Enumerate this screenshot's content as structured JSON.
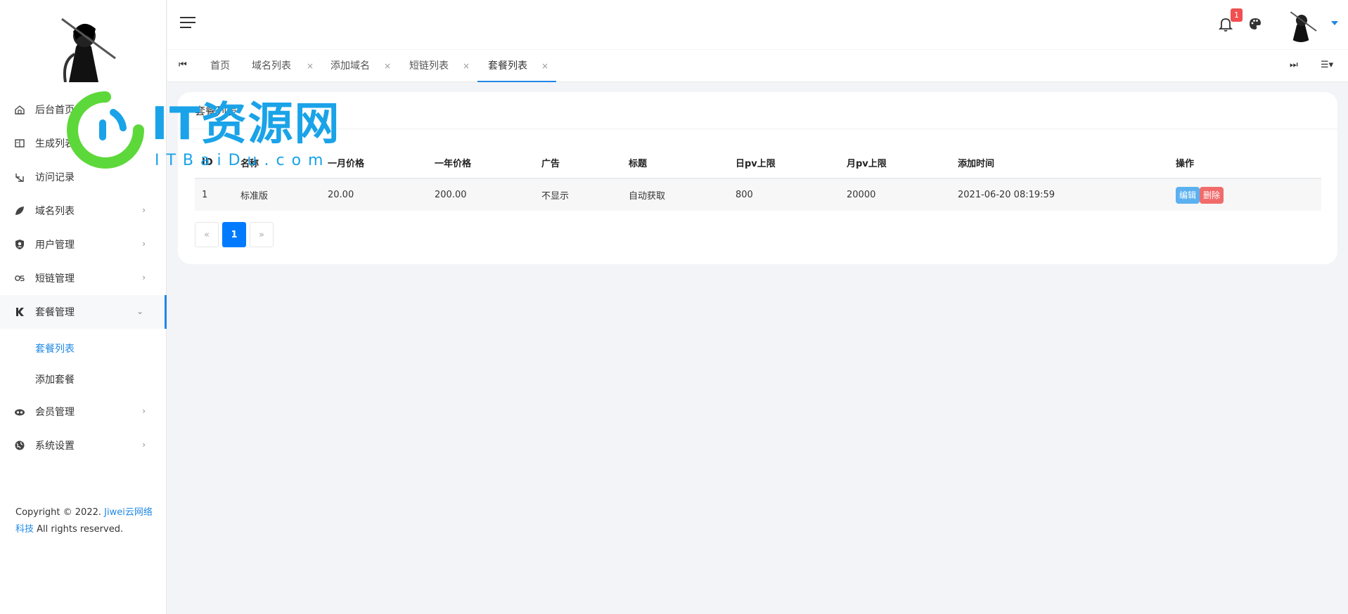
{
  "sidebar": {
    "items": [
      {
        "label": "后台首页",
        "icon": "house-icon"
      },
      {
        "label": "生成列表",
        "icon": "book-icon"
      },
      {
        "label": "访问记录",
        "icon": "history-icon"
      },
      {
        "label": "域名列表",
        "icon": "leaf-icon",
        "chevron": "›"
      },
      {
        "label": "用户管理",
        "icon": "user-shield-icon",
        "chevron": "›"
      },
      {
        "label": "短链管理",
        "icon": "link-icon",
        "chevron": "›"
      },
      {
        "label": "套餐管理",
        "icon": "k-icon",
        "chevron": "⌄"
      },
      {
        "label": "会员管理",
        "icon": "vip-icon",
        "chevron": "›"
      },
      {
        "label": "系统设置",
        "icon": "globe-icon",
        "chevron": "›"
      }
    ],
    "submenu": [
      "套餐列表",
      "添加套餐"
    ],
    "copyright_prefix": "Copyright © 2022. ",
    "copyright_link": "Jiwei云网络科技",
    "copyright_suffix": " All rights reserved."
  },
  "topbar": {
    "notification_count": "1"
  },
  "tabs": [
    {
      "label": "首页"
    },
    {
      "label": "域名列表"
    },
    {
      "label": "添加域名"
    },
    {
      "label": "短链列表"
    },
    {
      "label": "套餐列表",
      "active": true
    }
  ],
  "watermark": {
    "title": "IT资源网",
    "subtitle": "ITBaiDu.com"
  },
  "card": {
    "title": "套餐列表",
    "headers": [
      "ID",
      "名称",
      "一月价格",
      "一年价格",
      "广告",
      "标题",
      "日pv上限",
      "月pv上限",
      "添加时间",
      "操作"
    ],
    "rows": [
      {
        "id": "1",
        "name": "标准版",
        "month_price": "20.00",
        "year_price": "200.00",
        "ad": "不显示",
        "title": "自动获取",
        "day_pv": "800",
        "month_pv": "20000",
        "added": "2021-06-20 08:19:59"
      }
    ],
    "edit_label": "编辑",
    "delete_label": "删除",
    "pager": {
      "prev": "«",
      "current": "1",
      "next": "»"
    }
  },
  "colors": {
    "accent": "#1e88e5",
    "edit": "#5bb1f0",
    "delete": "#f16b6b",
    "page_active": "#007bff"
  }
}
